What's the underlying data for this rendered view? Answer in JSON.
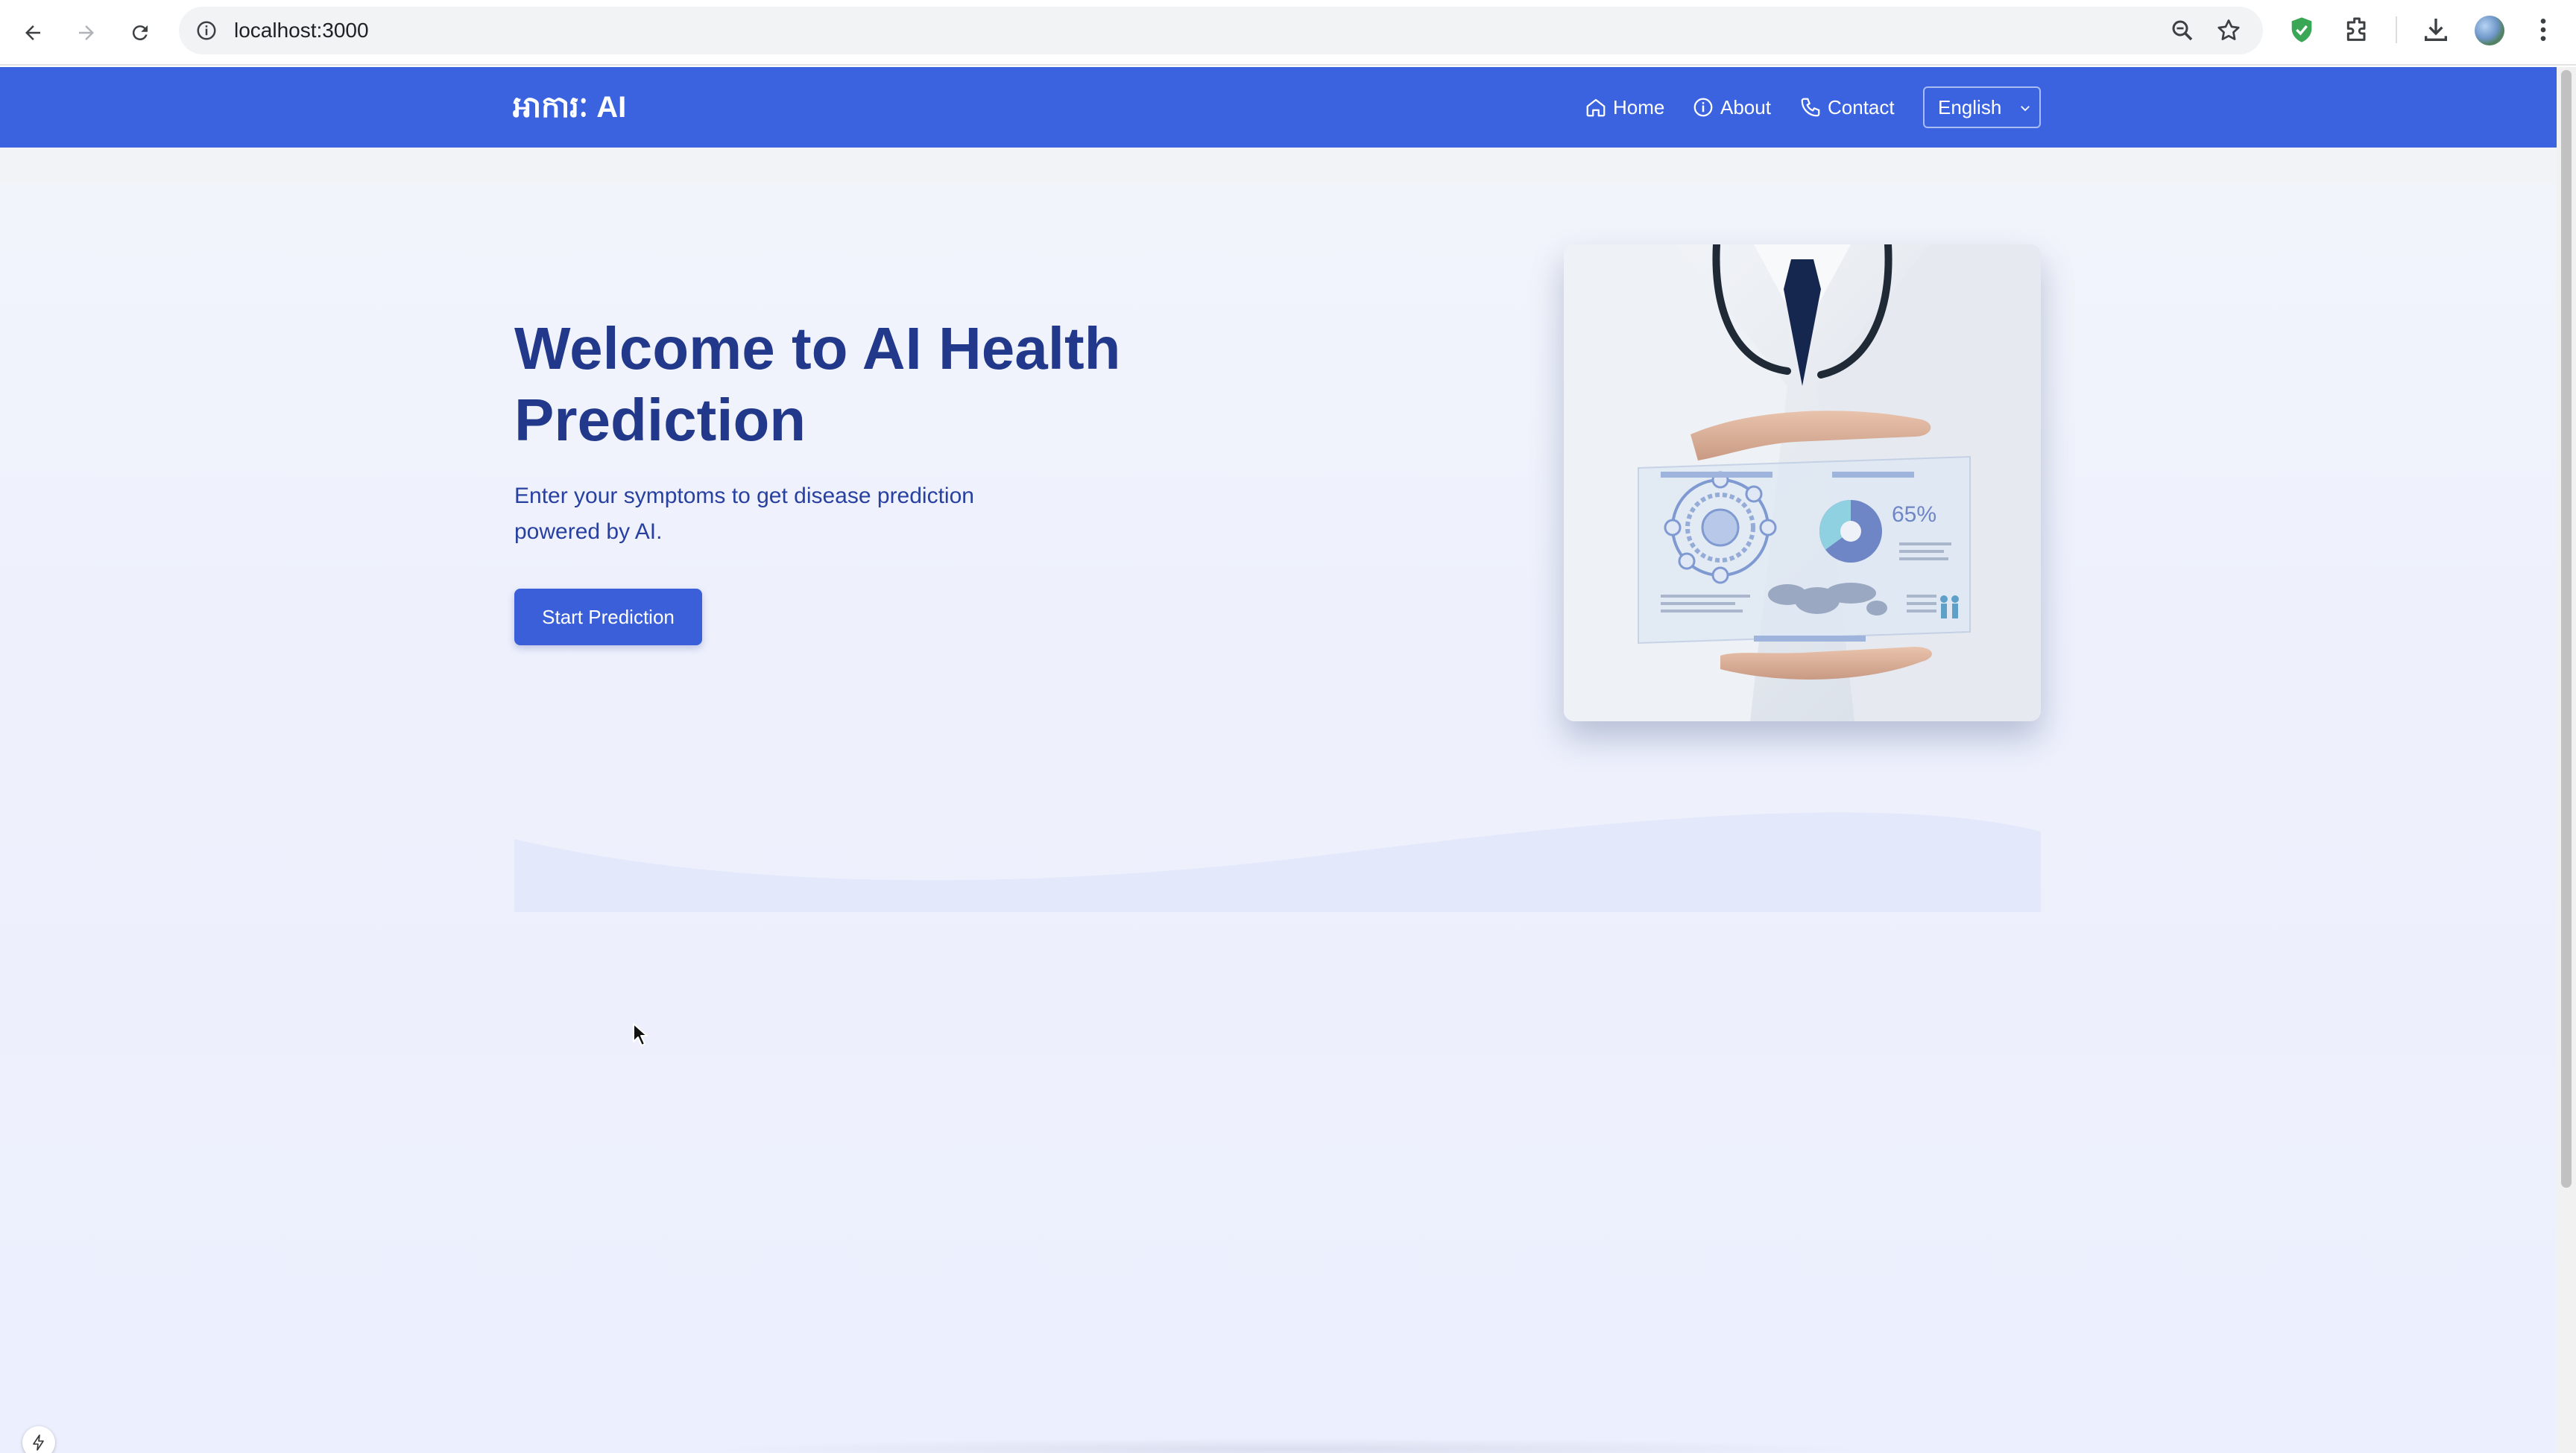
{
  "browser": {
    "url": "localhost:3000"
  },
  "header": {
    "logo": "អាការៈ AI",
    "nav": {
      "home": "Home",
      "about": "About",
      "contact": "Contact"
    },
    "language": {
      "selected": "English"
    },
    "colors": {
      "bar": "#3b63e0"
    }
  },
  "hero": {
    "title": "Welcome to AI Health Prediction",
    "subtitle": "Enter your symptoms to get disease prediction powered by AI.",
    "cta_label": "Start Prediction",
    "image": {
      "stat_text": "65%",
      "pie_fraction": 0.65
    },
    "colors": {
      "title": "#22388a",
      "accent": "#3b5fd9"
    }
  },
  "icons": {
    "back": "arrow-left-icon",
    "forward": "arrow-right-icon",
    "reload": "reload-icon",
    "info": "info-icon",
    "zoom": "zoom-icon",
    "bookmark": "star-icon",
    "home": "home-icon",
    "about": "info-circle-icon",
    "contact": "phone-icon"
  }
}
